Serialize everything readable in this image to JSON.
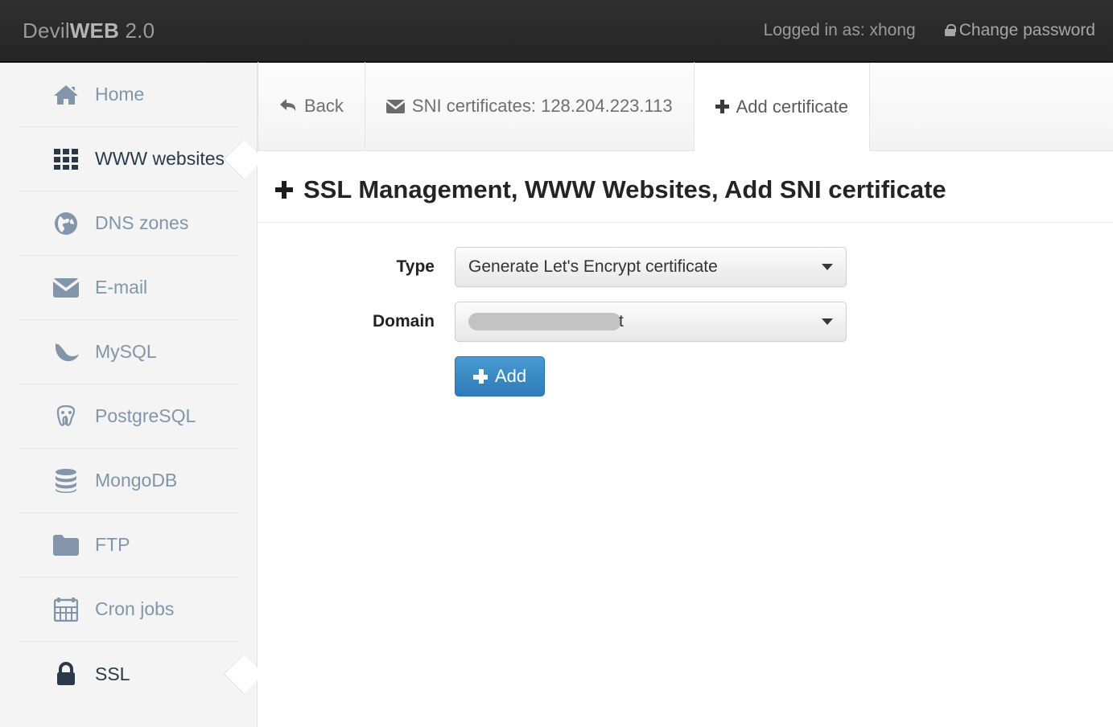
{
  "header": {
    "brand_prefix": "Devil",
    "brand_bold": "WEB",
    "brand_suffix": " 2.0",
    "logged_in": "Logged in as: xhong",
    "change_password": "Change password",
    "lock_icon": "lock-icon"
  },
  "sidebar": {
    "items": [
      {
        "label": "Home",
        "icon": "home-icon",
        "active": false
      },
      {
        "label": "WWW websites",
        "icon": "grid-icon",
        "active": true
      },
      {
        "label": "DNS zones",
        "icon": "globe-icon",
        "active": false
      },
      {
        "label": "E-mail",
        "icon": "envelope-icon",
        "active": false
      },
      {
        "label": "MySQL",
        "icon": "dolphin-icon",
        "active": false
      },
      {
        "label": "PostgreSQL",
        "icon": "elephant-icon",
        "active": false
      },
      {
        "label": "MongoDB",
        "icon": "database-icon",
        "active": false
      },
      {
        "label": "FTP",
        "icon": "folder-icon",
        "active": false
      },
      {
        "label": "Cron jobs",
        "icon": "calendar-icon",
        "active": false
      },
      {
        "label": "SSL",
        "icon": "lock-icon",
        "active": true
      }
    ]
  },
  "tabs": [
    {
      "label": "Back",
      "icon": "back-arrow-icon",
      "active": false
    },
    {
      "label": "SNI certificates: 128.204.223.113",
      "icon": "envelope-icon",
      "active": false
    },
    {
      "label": "Add certificate",
      "icon": "plus-icon",
      "active": true
    }
  ],
  "page": {
    "title": "SSL Management, WWW Websites, Add SNI certificate",
    "title_icon": "plus-icon"
  },
  "form": {
    "type_label": "Type",
    "type_value": "Generate Let's Encrypt certificate",
    "domain_label": "Domain",
    "domain_value": "t",
    "domain_redacted": true,
    "add_button": "Add"
  },
  "colors": {
    "header_bg": "#2a2a2a",
    "sidebar_bg": "#f4f4f4",
    "nav_text": "#8295ab",
    "nav_active_text": "#2b3a4a",
    "accent_button": "#3a8ac4",
    "redaction": "#c3c3c3"
  }
}
